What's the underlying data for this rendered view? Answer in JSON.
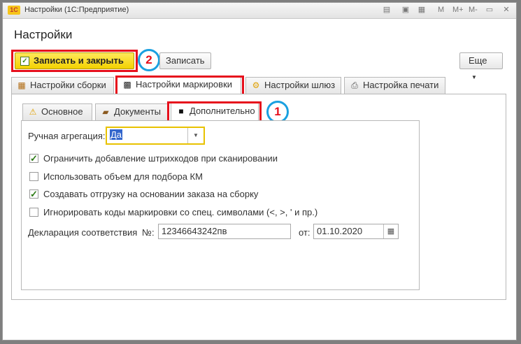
{
  "window": {
    "title": "Настройки (1С:Предприятие)",
    "logo": "1С",
    "toolbar_m": "M",
    "toolbar_mplus": "M+",
    "toolbar_mminus": "M-"
  },
  "page": {
    "title": "Настройки"
  },
  "toolbar": {
    "save_close_label": "Записать и закрыть",
    "save_label": "Записать",
    "more_label": "Еще"
  },
  "tabs": [
    {
      "label": "Настройки сборки",
      "icon": "assembly-icon"
    },
    {
      "label": "Настройки маркировки",
      "icon": "qr-code-icon"
    },
    {
      "label": "Настройки шлюз",
      "icon": "gateway-icon"
    },
    {
      "label": "Настройка печати",
      "icon": "printer-icon"
    }
  ],
  "subtabs": [
    {
      "label": "Основное",
      "icon": "warning-icon"
    },
    {
      "label": "Документы",
      "icon": "briefcase-icon"
    },
    {
      "label": "Дополнительно",
      "icon": "chat-icon"
    }
  ],
  "form": {
    "manual_aggregation_label": "Ручная агрегация:",
    "manual_aggregation_value": "Да",
    "checkboxes": [
      {
        "label": "Ограничить добавление штрихкодов при сканировании",
        "checked": true
      },
      {
        "label": "Использовать объем для подбора КМ",
        "checked": false
      },
      {
        "label": "Создавать отгрузку на основании заказа на сборку",
        "checked": true
      },
      {
        "label": "Игнорировать коды маркировки со спец. символами (<, >, ' и пр.)",
        "checked": false
      }
    ],
    "declaration_label": "Декларация соответствия",
    "number_label": "№:",
    "number_value": "12346643242пв",
    "date_label": "от:",
    "date_value": "01.10.2020"
  },
  "annotations": {
    "callout_1": "1",
    "callout_2": "2"
  },
  "colors": {
    "highlight": "#e6101c",
    "callout_ring": "#1aa0e0",
    "primary": "#f3d100"
  }
}
